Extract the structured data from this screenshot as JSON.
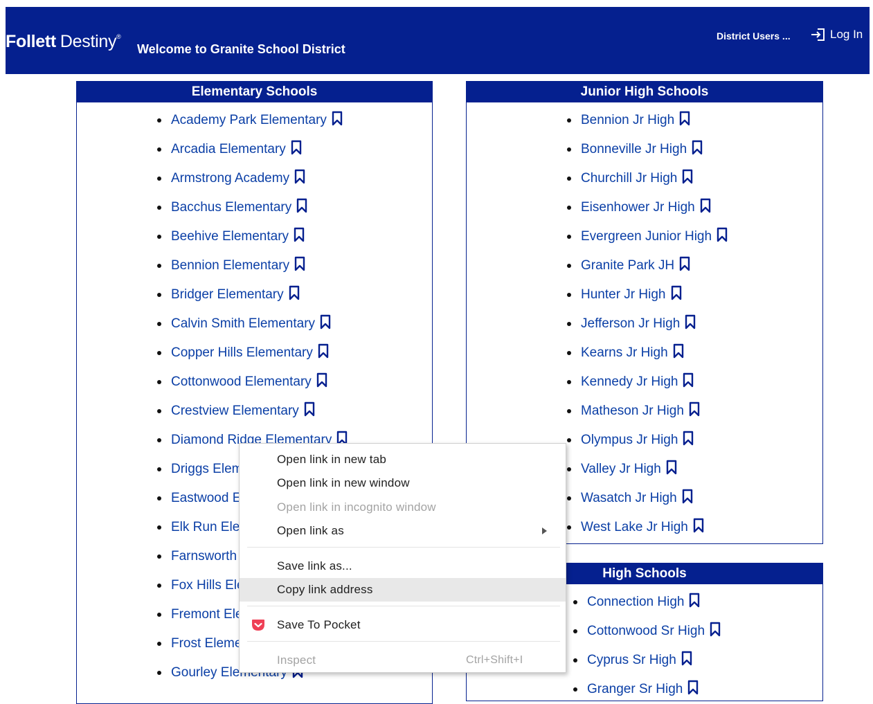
{
  "header": {
    "brand": "Follett",
    "product": "Destiny",
    "reg_mark": "®",
    "welcome": "Welcome to Granite School District",
    "district_users": "District Users ...",
    "login_label": "Log In",
    "background_color": "#05208f"
  },
  "elementary": {
    "title": "Elementary Schools",
    "schools": [
      "Academy Park Elementary",
      "Arcadia Elementary",
      "Armstrong Academy",
      "Bacchus Elementary",
      "Beehive Elementary",
      "Bennion Elementary",
      "Bridger Elementary",
      "Calvin Smith Elementary",
      "Copper Hills Elementary",
      "Cottonwood Elementary",
      "Crestview Elementary",
      "Diamond Ridge Elementary",
      "Driggs Elementary",
      "Eastwood Elementary",
      "Elk Run Elementary",
      "Farnsworth Elementary",
      "Fox Hills Elementary",
      "Fremont Elementary",
      "Frost Elementary",
      "Gourley Elementary"
    ]
  },
  "junior_high": {
    "title": "Junior High Schools",
    "schools": [
      "Bennion Jr High",
      "Bonneville Jr High",
      "Churchill Jr High",
      "Eisenhower Jr High",
      "Evergreen Junior High",
      "Granite Park JH",
      "Hunter Jr High",
      "Jefferson Jr High",
      "Kearns Jr High",
      "Kennedy Jr High",
      "Matheson Jr High",
      "Olympus Jr High",
      "Valley Jr High",
      "Wasatch Jr High",
      "West Lake Jr High"
    ]
  },
  "high": {
    "title": "High Schools",
    "schools": [
      "Connection High",
      "Cottonwood Sr High",
      "Cyprus Sr High",
      "Granger Sr High"
    ]
  },
  "context_menu": {
    "items": [
      {
        "label": "Open link in new tab"
      },
      {
        "label": "Open link in new window"
      },
      {
        "label": "Open link in incognito window",
        "disabled": true
      },
      {
        "label": "Open link as",
        "submenu": true
      },
      {
        "label": "Save link as..."
      },
      {
        "label": "Copy link address",
        "highlighted": true
      },
      {
        "label": "Save To Pocket",
        "icon": "pocket-icon"
      },
      {
        "label": "Inspect",
        "shortcut": "Ctrl+Shift+I",
        "disabled": true
      }
    ]
  },
  "colors": {
    "accent": "#05208f",
    "link": "#0b3fa6",
    "pocket": "#ef4056"
  }
}
